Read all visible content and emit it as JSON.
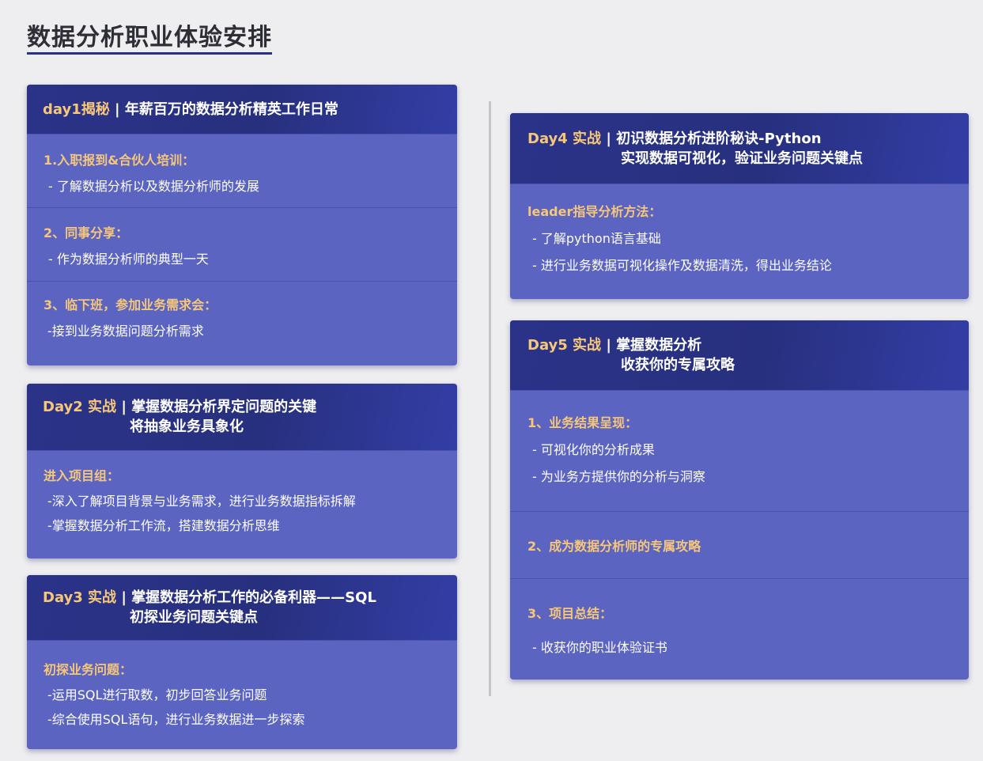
{
  "page": {
    "title": "数据分析职业体验安排"
  },
  "colors": {
    "background": "#eeeef0",
    "card": "#5b64c1",
    "header": "#27307e",
    "accent": "#f6c779"
  },
  "days": [
    {
      "day_label": "day1揭秘",
      "title_line1": "| 年薪百万的数据分析精英工作日常",
      "title_line2": "",
      "sections": [
        {
          "title": "1.入职报到&合伙人培训：",
          "items": [
            "- 了解数据分析以及数据分析师的发展"
          ]
        },
        {
          "title": "2、同事分享：",
          "items": [
            "- 作为数据分析师的典型一天"
          ]
        },
        {
          "title": "3、临下班，参加业务需求会：",
          "items": [
            "-接到业务数据问题分析需求"
          ]
        }
      ]
    },
    {
      "day_label": "Day2 实战",
      "title_line1": "| 掌握数据分析界定问题的关键",
      "title_line2": "将抽象业务具象化",
      "sections": [
        {
          "title": "进入项目组：",
          "items": [
            "-深入了解项目背景与业务需求，进行业务数据指标拆解",
            "-掌握数据分析工作流，搭建数据分析思维"
          ]
        }
      ]
    },
    {
      "day_label": "Day3 实战",
      "title_line1": "| 掌握数据分析工作的必备利器——SQL",
      "title_line2": "初探业务问题关键点",
      "sections": [
        {
          "title": "初探业务问题：",
          "items": [
            "-运用SQL进行取数，初步回答业务问题",
            "-综合使用SQL语句，进行业务数据进一步探索"
          ]
        }
      ]
    },
    {
      "day_label": "Day4 实战",
      "title_line1": "| 初识数据分析进阶秘诀-Python",
      "title_line2": "实现数据可视化，验证业务问题关键点",
      "sections": [
        {
          "title": "leader指导分析方法：",
          "items": [
            "- 了解python语言基础",
            "- 进行业务数据可视化操作及数据清洗，得出业务结论"
          ]
        }
      ]
    },
    {
      "day_label": "Day5 实战",
      "title_line1": "| 掌握数据分析",
      "title_line2": "收获你的专属攻略",
      "sections": [
        {
          "title": "1、业务结果呈现：",
          "items": [
            "- 可视化你的分析成果",
            "- 为业务方提供你的分析与洞察"
          ]
        },
        {
          "title": "2、成为数据分析师的专属攻略",
          "items": []
        },
        {
          "title": "3、项目总结：",
          "items": [
            "- 收获你的职业体验证书"
          ]
        }
      ]
    }
  ]
}
